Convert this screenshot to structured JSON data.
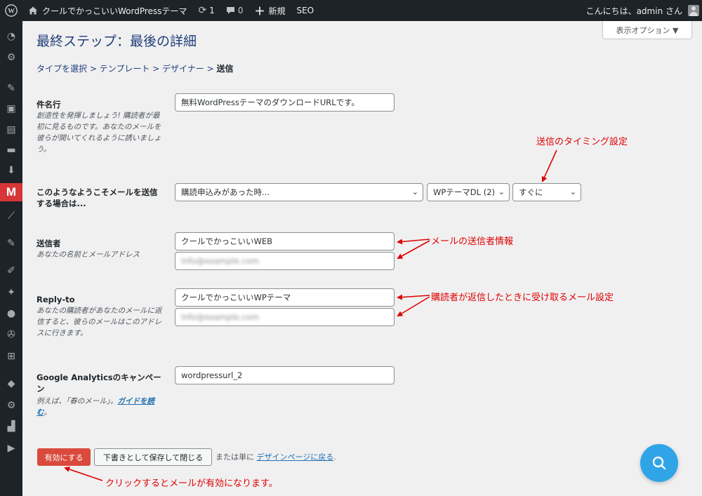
{
  "adminbar": {
    "site_name": "クールでかっこいいWordPressテーマ",
    "updates_count": "1",
    "comments_count": "0",
    "new_label": "新規",
    "seo_label": "SEO",
    "greeting": "こんにちは、admin さん"
  },
  "screen_options": "表示オプション ▼",
  "page_title": "最終ステップ：最後の詳細",
  "breadcrumb": {
    "trail": "タイプを選択 > テンプレート > デザイナー > ",
    "current": "送信"
  },
  "fields": {
    "subject": {
      "label": "件名行",
      "desc": "創造性を発揮しましょう! 購読者が最初に見るものです。あなたのメールを彼らが開いてくれるように誘いましょう。",
      "value": "無料WordPressテーマのダウンロードURLです。"
    },
    "trigger": {
      "label": "このようなようこそメールを送信する場合は...",
      "event": "購読申込みがあった時...",
      "list": "WPテーマDL (2)",
      "timing": "すぐに"
    },
    "sender": {
      "label": "送信者",
      "desc": "あなたの名前とメールアドレス",
      "name": "クールでかっこいいWEB",
      "email": "info@example.com"
    },
    "reply_to": {
      "label": "Reply-to",
      "desc": "あなたの購読者があなたのメールに返信すると、彼らのメールはこのアドレスに行きます。",
      "name": "クールでかっこいいWPテーマ",
      "email": "info@example.com"
    },
    "ga_campaign": {
      "label": "Google Analyticsのキャンペーン",
      "desc_prefix": "例えば、「春のメール」。",
      "desc_link": "ガイドを読む",
      "desc_suffix": "。",
      "value": "wordpressurl_2"
    }
  },
  "actions": {
    "activate": "有効にする",
    "save_draft": "下書きとして保存して閉じる",
    "or_text": "または単に",
    "back_link": "デザインページに戻る",
    "back_suffix": "."
  },
  "annotations": {
    "timing": "送信のタイミング設定",
    "sender": "メールの送信者情報",
    "reply": "購読者が返信したときに受け取るメール設定",
    "activate": "クリックするとメールが有効になります。"
  },
  "colors": {
    "accent": "#d94a3d",
    "annotation": "#e00000",
    "link": "#2271b1",
    "fab": "#2fa4e7"
  }
}
